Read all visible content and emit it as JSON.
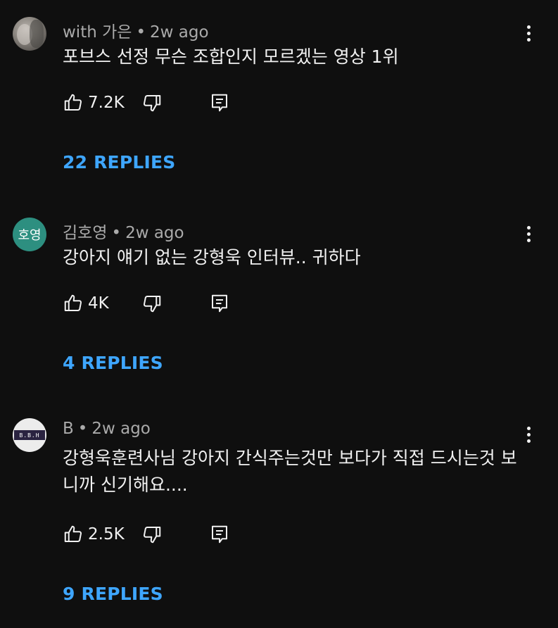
{
  "comments": [
    {
      "author": "with 가은",
      "time": "2w ago",
      "avatar_type": "photo",
      "text": "포브스 선정 무슨 조합인지 모르겠는 영상 1위",
      "likes": "7.2K",
      "replies": "22 REPLIES"
    },
    {
      "author": "김호영",
      "time": "2w ago",
      "avatar_type": "initials",
      "avatar_text": "호영",
      "avatar_color": "#2d8f80",
      "text": "강아지 얘기 없는 강형욱 인터뷰.. 귀하다",
      "likes": "4K",
      "replies": "4 REPLIES"
    },
    {
      "author": "B",
      "time": "2w ago",
      "avatar_type": "logo",
      "avatar_text": "B.B.H",
      "text": "강형욱훈련사님 강아지 간식주는것만 보다가 직접 드시는것 보니까 신기해요....",
      "likes": "2.5K",
      "replies": "9 REPLIES"
    }
  ],
  "colors": {
    "background": "#0f0f0f",
    "text": "#f1f1f1",
    "meta": "#aaaaaa",
    "link": "#3ea6ff"
  },
  "icons": {
    "like": "thumbs-up-icon",
    "dislike": "thumbs-down-icon",
    "reply": "comment-icon",
    "menu": "more-vertical-icon"
  }
}
